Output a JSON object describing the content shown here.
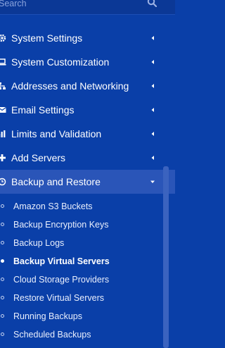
{
  "search": {
    "placeholder": "Search"
  },
  "menu": [
    {
      "label": "System Settings",
      "icon": "gear-icon"
    },
    {
      "label": "System Customization",
      "icon": "laptop-icon"
    },
    {
      "label": "Addresses and Networking",
      "icon": "network-icon"
    },
    {
      "label": "Email Settings",
      "icon": "envelope-icon"
    },
    {
      "label": "Limits and Validation",
      "icon": "bar-chart-icon"
    },
    {
      "label": "Add Servers",
      "icon": "plus-icon"
    },
    {
      "label": "Backup and Restore",
      "icon": "history-icon",
      "expanded": true
    }
  ],
  "submenu": [
    {
      "label": "Amazon S3 Buckets"
    },
    {
      "label": "Backup Encryption Keys"
    },
    {
      "label": "Backup Logs"
    },
    {
      "label": "Backup Virtual Servers",
      "active": true
    },
    {
      "label": "Cloud Storage Providers"
    },
    {
      "label": "Restore Virtual Servers"
    },
    {
      "label": "Running Backups"
    },
    {
      "label": "Scheduled Backups"
    }
  ],
  "colors": {
    "background": "#0a3fa8",
    "active_row": "#2a55b8",
    "text": "#ffffff"
  }
}
